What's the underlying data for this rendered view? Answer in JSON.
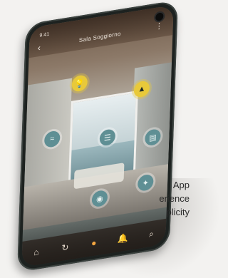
{
  "caption": {
    "lines": [
      "App",
      "erience",
      "plicity"
    ]
  },
  "phone": {
    "status_time": "9:41",
    "screen_title": "Sala Soggiorno",
    "hotspots": [
      {
        "name": "light-hotspot",
        "icon": "bulb-icon",
        "glyph": "💡",
        "color": "#e8c93a"
      },
      {
        "name": "shade-hotspot",
        "icon": "lamp-icon",
        "glyph": "▲",
        "color": "#e8c93a"
      },
      {
        "name": "climate-hotspot",
        "icon": "thermostat-icon",
        "glyph": "≈",
        "color": "#5f8f94"
      },
      {
        "name": "window-hotspot",
        "icon": "blind-icon",
        "glyph": "☰",
        "color": "#5f8f94"
      },
      {
        "name": "curtain-hotspot",
        "icon": "curtain-icon",
        "glyph": "▤",
        "color": "#5f8f94"
      },
      {
        "name": "speaker-hotspot",
        "icon": "speaker-icon",
        "glyph": "◉",
        "color": "#5f8f94"
      },
      {
        "name": "scene-hotspot",
        "icon": "scene-icon",
        "glyph": "✦",
        "color": "#5f8f94"
      }
    ],
    "nav": [
      {
        "name": "nav-home",
        "icon": "home-icon",
        "glyph": "⌂"
      },
      {
        "name": "nav-scenes",
        "icon": "refresh-icon",
        "glyph": "↻"
      },
      {
        "name": "nav-rooms",
        "icon": "dot-icon",
        "glyph": "●"
      },
      {
        "name": "nav-alerts",
        "icon": "bell-icon",
        "glyph": "🔔"
      },
      {
        "name": "nav-search",
        "icon": "search-icon",
        "glyph": "⌕"
      }
    ]
  }
}
